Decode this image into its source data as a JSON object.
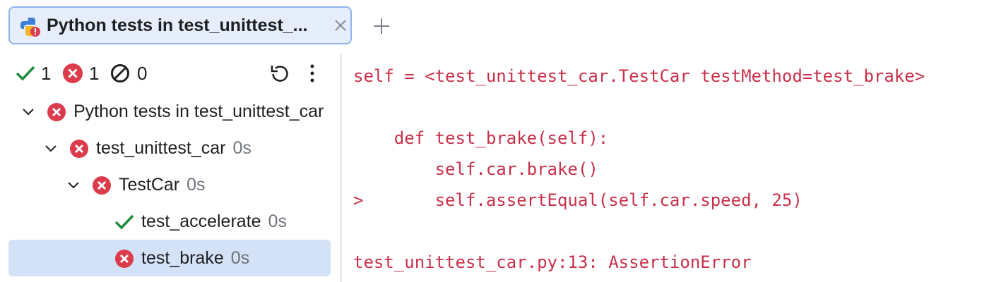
{
  "tab": {
    "title": "Python tests in test_unittest_...",
    "icon": "python-test-error-icon"
  },
  "toolbar": {
    "passed_count": "1",
    "failed_count": "1",
    "ignored_count": "0"
  },
  "tree": {
    "root": {
      "label": "Python tests in test_unittest_car",
      "status": "failed"
    },
    "module": {
      "label": "test_unittest_car",
      "time": "0s",
      "status": "failed"
    },
    "class": {
      "label": "TestCar",
      "time": "0s",
      "status": "failed"
    },
    "tests": [
      {
        "label": "test_accelerate",
        "time": "0s",
        "status": "passed"
      },
      {
        "label": "test_brake",
        "time": "0s",
        "status": "failed",
        "selected": true
      }
    ]
  },
  "console": {
    "lines": [
      "self = <test_unittest_car.TestCar testMethod=test_brake>",
      "",
      "    def test_brake(self):",
      "        self.car.brake()",
      ">       self.assertEqual(self.car.speed, 25)",
      "",
      "test_unittest_car.py:13: AssertionError"
    ]
  },
  "colors": {
    "error": "#db3b4b",
    "success": "#208a3c",
    "console_text": "#c9304a",
    "selection": "#d4e2f8",
    "tab_border": "#8fb3ee"
  }
}
